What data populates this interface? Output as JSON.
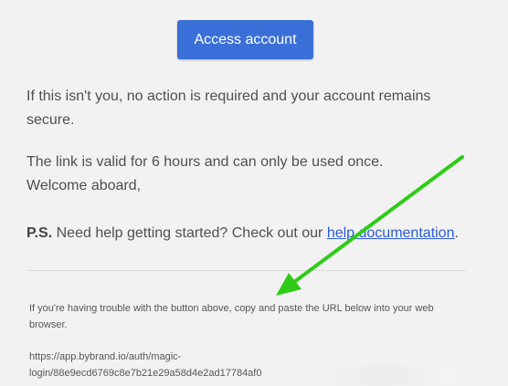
{
  "email": {
    "cta_label": "Access account",
    "para1": "If this isn't you, no action is required and your account remains secure.",
    "para2_line1": "The link is valid for 6 hours and can only be used once.",
    "para2_line2": "Welcome aboard,",
    "ps_label": "P.S.",
    "ps_text": " Need help getting started? Check out our ",
    "ps_link": "help documentation",
    "ps_end": ".",
    "fallback_text": "If you're having trouble with the button above, copy and paste the URL below into your web browser.",
    "url_line1": "https://app.bybrand.io/auth/magic-",
    "url_line2": "login/88e9ecd6769c8e7b21e29a58d4e2ad17784af0"
  },
  "annotation": {
    "arrow_color": "#2ecc18",
    "arrow_icon": "pointer-arrow-icon"
  }
}
